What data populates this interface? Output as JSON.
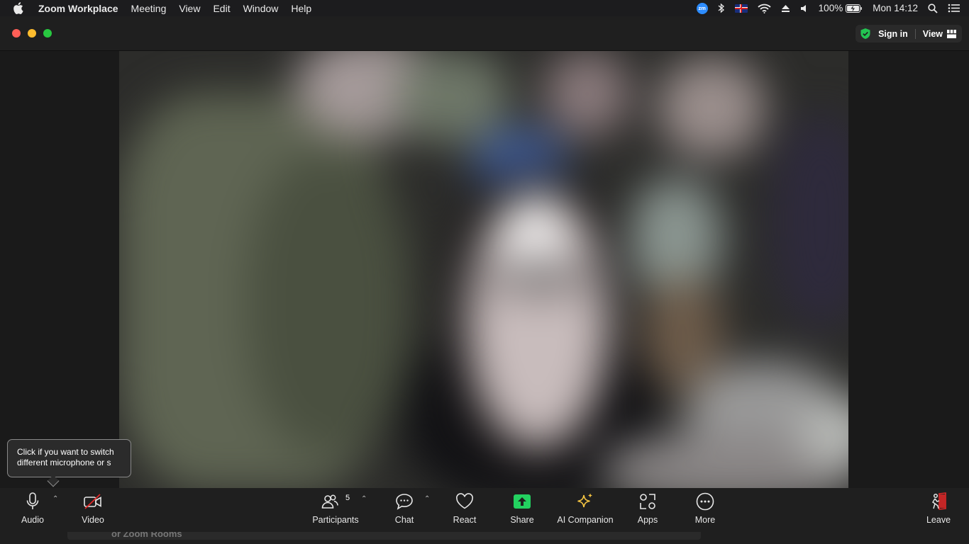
{
  "menubar": {
    "app_name": "Zoom Workplace",
    "items": [
      "Meeting",
      "View",
      "Edit",
      "Window",
      "Help"
    ],
    "status": {
      "zoom_badge": "zm",
      "battery": "100%",
      "clock": "Mon 14:12"
    }
  },
  "titlebar": {
    "sign_in": "Sign in",
    "view": "View"
  },
  "tooltip": {
    "line1": "Click if you want to switch",
    "line2": "different microphone or s"
  },
  "toolbar": {
    "audio": "Audio",
    "video": "Video",
    "participants": "Participants",
    "participants_count": "5",
    "chat": "Chat",
    "react": "React",
    "share": "Share",
    "ai_companion": "AI Companion",
    "apps": "Apps",
    "more": "More",
    "leave": "Leave"
  },
  "bottom_panel": {
    "text": "or Zoom Rooms"
  },
  "colors": {
    "share_green": "#23d160",
    "ai_star": "#f5c542",
    "leave_red": "#e02828",
    "video_off_red": "#e02828"
  }
}
